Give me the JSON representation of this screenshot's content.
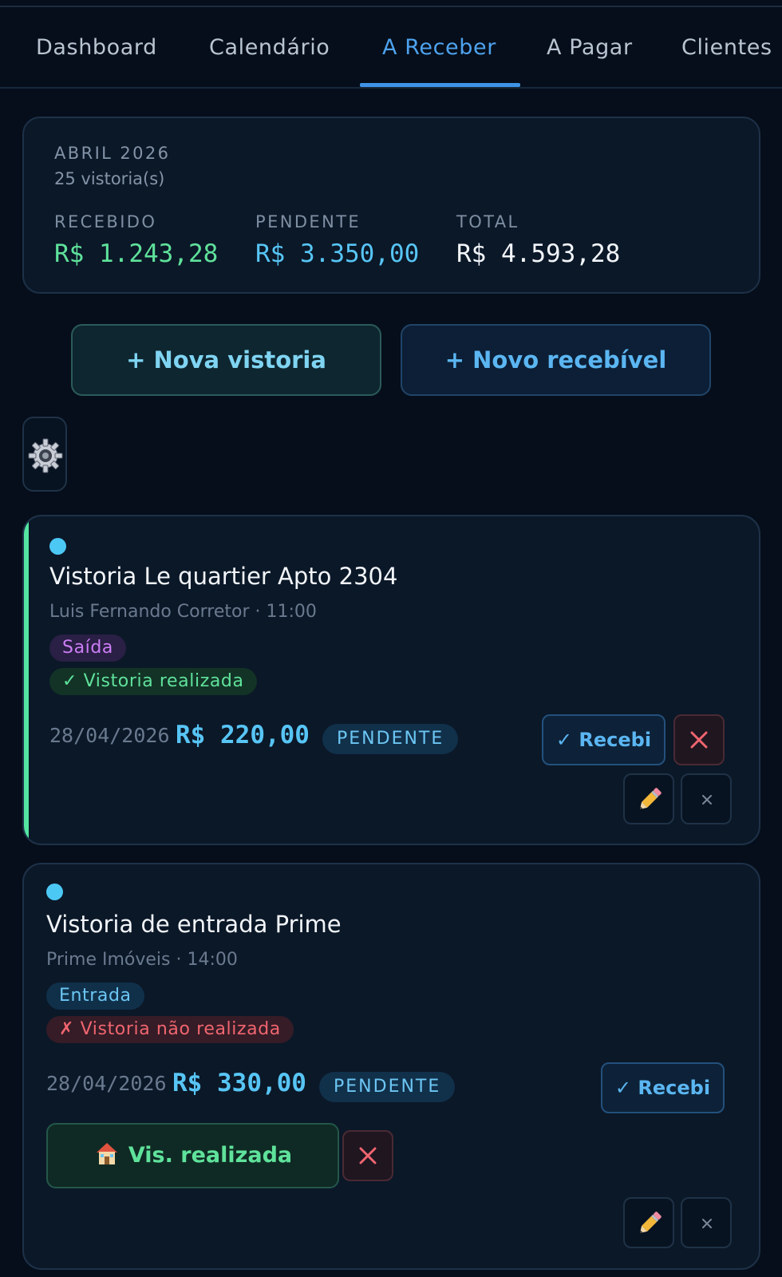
{
  "tabs": [
    {
      "label": "Dashboard"
    },
    {
      "label": "Calendário"
    },
    {
      "label": "A Receber",
      "active": true
    },
    {
      "label": "A Pagar"
    },
    {
      "label": "Clientes"
    }
  ],
  "summary": {
    "month": "ABRIL 2026",
    "count": "25 vistoria(s)",
    "recebido_label": "RECEBIDO",
    "recebido_value": "R$ 1.243,28",
    "pendente_label": "PENDENTE",
    "pendente_value": "R$ 3.350,00",
    "total_label": "TOTAL",
    "total_value": "R$ 4.593,28"
  },
  "actions": {
    "nova_vistoria": "+ Nova vistoria",
    "novo_recebivel": "+ Novo recebível"
  },
  "cards": [
    {
      "title": "Vistoria Le quartier Apto 2304",
      "subtitle": "Luis Fernando Corretor · 11:00",
      "type_tag": "Saída",
      "status_tag": "✓ Vistoria realizada",
      "date": "28/04/2026",
      "amount": "R$ 220,00",
      "payment_status": "PENDENTE",
      "recebi_label": "✓ Recebi"
    },
    {
      "title": "Vistoria de entrada Prime",
      "subtitle": "Prime Imóveis · 14:00",
      "type_tag": "Entrada",
      "status_tag": "✗ Vistoria não realizada",
      "date": "28/04/2026",
      "amount": "R$ 330,00",
      "payment_status": "PENDENTE",
      "recebi_label": "✓ Recebi",
      "vis_realizada_label": "Vis. realizada"
    }
  ],
  "icons": {
    "settings": "gear-icon",
    "delete": "close-icon",
    "edit": "pencil-icon",
    "remove": "small-x-icon",
    "house": "house-icon"
  },
  "colors": {
    "background": "#050e1a",
    "active_tab": "#4ea2ee",
    "recebido": "#5fe29b",
    "pendente": "#57c5f5",
    "accent_green": "#54e6a0",
    "danger": "#f0656f"
  }
}
